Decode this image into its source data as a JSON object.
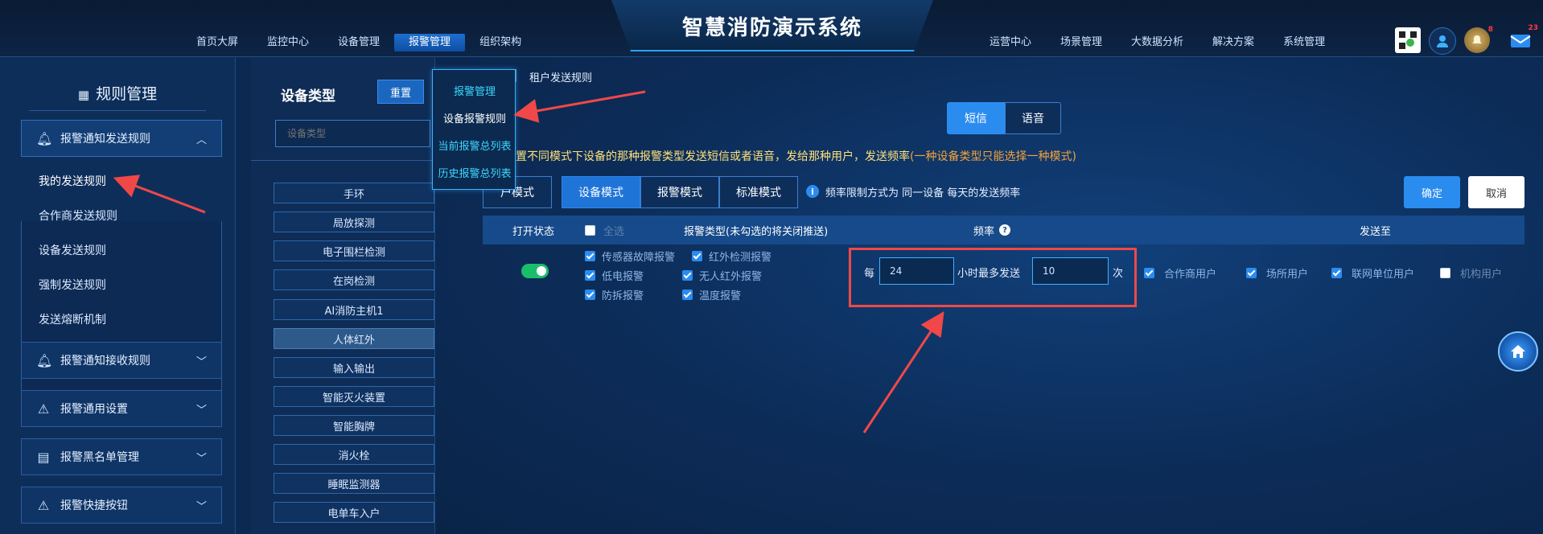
{
  "header": {
    "title": "智慧消防演示系统",
    "nav_left": [
      "首页大屏",
      "监控中心",
      "设备管理",
      "报警管理",
      "组织架构"
    ],
    "nav_left_active": 3,
    "nav_right": [
      "运营中心",
      "场景管理",
      "大数据分析",
      "解决方案",
      "系统管理"
    ],
    "icons": [
      "qr-code-icon",
      "user-avatar-icon",
      "alarm-bell-icon",
      "message-icon"
    ],
    "badges": {
      "bell": "8",
      "message": "23"
    }
  },
  "sidebar": {
    "title": "规则管理",
    "groups": [
      {
        "label": "报警通知发送规则",
        "icon": "bell-icon",
        "expanded": true
      },
      {
        "label": "报警通知接收规则",
        "icon": "bell-icon",
        "expanded": false
      },
      {
        "label": "报警通用设置",
        "icon": "siren-icon",
        "expanded": false
      },
      {
        "label": "报警黑名单管理",
        "icon": "document-icon",
        "expanded": false
      },
      {
        "label": "报警快捷按钮",
        "icon": "siren-icon",
        "expanded": false
      }
    ],
    "sub_items": [
      "我的发送规则",
      "合作商发送规则",
      "设备发送规则",
      "强制发送规则",
      "发送熔断机制"
    ]
  },
  "device_panel": {
    "title": "设备类型",
    "reset_label": "重置",
    "input_placeholder": "设备类型",
    "items": [
      "手环",
      "局放探测",
      "电子围栏检测",
      "在岗检测",
      "AI消防主机1",
      "人体红外",
      "输入输出",
      "智能灭火装置",
      "智能胸牌",
      "消火栓",
      "睡眠监测器",
      "电单车入户"
    ],
    "active_index": 5
  },
  "dropdown": {
    "items": [
      "报警管理",
      "设备报警规则",
      "当前报警总列表",
      "历史报警总列表"
    ],
    "colors": [
      "#3cd6ff",
      "#ffffff",
      "#3cd6ff",
      "#3cd6ff"
    ]
  },
  "main": {
    "breadcrumb": "租户发送规则",
    "channel_tabs": {
      "sms": "短信",
      "voice": "语音",
      "active": "sms"
    },
    "description": "置不同模式下设备的那种报警类型发送短信或者语音，发给那种用户，发送频率",
    "description_highlight": "(一种设备类型只能选择一种模式)",
    "mode_tabs": [
      "户模式",
      "设备模式",
      "报警模式",
      "标准模式"
    ],
    "mode_active": 1,
    "freq_note": "频率限制方式为 同一设备 每天的发送频率",
    "confirm_label": "确定",
    "cancel_label": "取消",
    "table_headers": {
      "status": "打开状态",
      "select_all": "全选",
      "alarm_type": "报警类型(未勾选的将关闭推送)",
      "frequency": "频率",
      "send_to": "发送至"
    },
    "row": {
      "enabled": true,
      "alarm_types": [
        {
          "label": "传感器故障报警",
          "checked": true
        },
        {
          "label": "红外检测报警",
          "checked": true
        },
        {
          "label": "低电报警",
          "checked": true
        },
        {
          "label": "无人红外报警",
          "checked": true
        },
        {
          "label": "防拆报警",
          "checked": true
        },
        {
          "label": "温度报警",
          "checked": true
        }
      ],
      "freq_prefix": "每",
      "hours_value": "24",
      "freq_middle": "小时最多发送",
      "times_value": "10",
      "freq_suffix": "次",
      "targets": [
        {
          "label": "合作商用户",
          "checked": true
        },
        {
          "label": "场所用户",
          "checked": true
        },
        {
          "label": "联网单位用户",
          "checked": true
        },
        {
          "label": "机构用户",
          "checked": false
        }
      ]
    }
  },
  "accent_colors": {
    "primary": "#2b8cf0",
    "annotation": "#f04848",
    "toggle_on": "#19be6b"
  }
}
